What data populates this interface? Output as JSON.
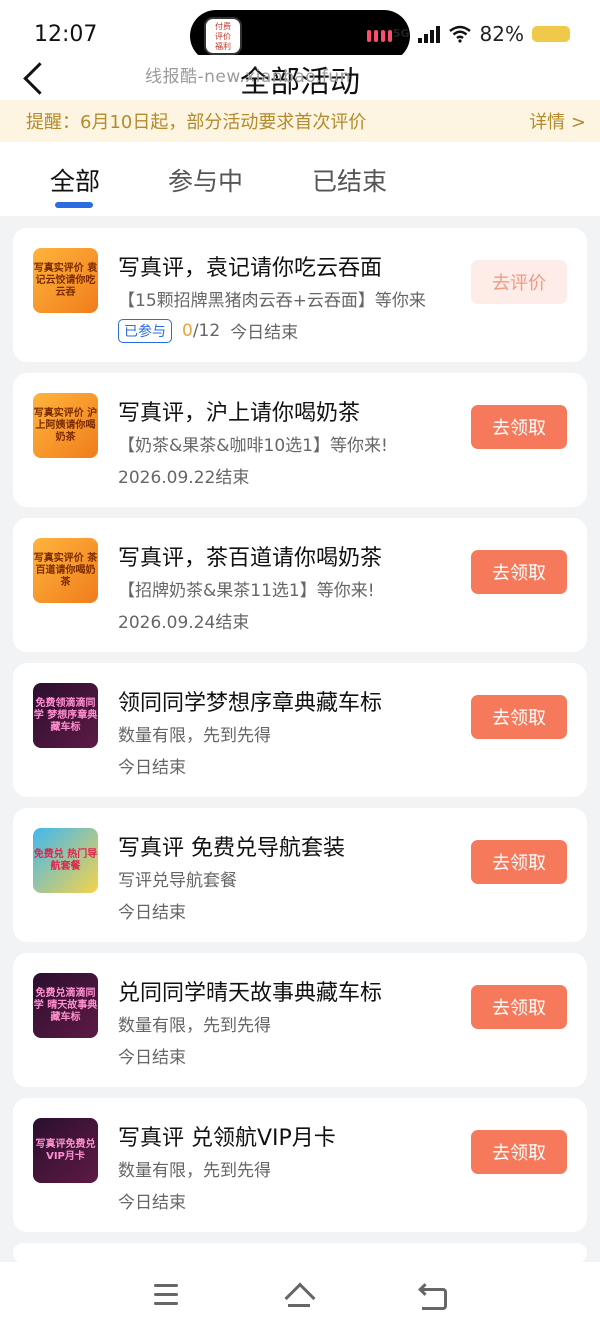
{
  "status_bar": {
    "time": "12:07",
    "network": "5G",
    "battery": "82%"
  },
  "header": {
    "title": "全部活动",
    "watermark": "线报酷-new.xianbao.fun"
  },
  "notice": {
    "text": "提醒：6月10日起，部分活动要求首次评价",
    "detail": "详情 >"
  },
  "tabs": [
    {
      "label": "全部",
      "active": true
    },
    {
      "label": "参与中",
      "active": false
    },
    {
      "label": "已结束",
      "active": false
    }
  ],
  "activities": [
    {
      "thumb_text": "写真实评价 袁记云饺请你吃云吞",
      "title": "写真评，袁记请你吃云吞面",
      "subtitle": "【15颗招牌黑猪肉云吞+云吞面】等你来",
      "joined_badge": "已参与",
      "progress_done": "0",
      "progress_total": "/12",
      "end_text": "今日结束",
      "button": "去评价"
    },
    {
      "thumb_text": "写真实评价 沪上阿姨请你喝奶茶",
      "title": "写真评，沪上请你喝奶茶",
      "subtitle": "【奶茶&果茶&咖啡10选1】等你来!",
      "end_text": "2026.09.22结束",
      "button": "去领取"
    },
    {
      "thumb_text": "写真实评价 茶百道请你喝奶茶",
      "title": "写真评，茶百道请你喝奶茶",
      "subtitle": "【招牌奶茶&果茶11选1】等你来!",
      "end_text": "2026.09.24结束",
      "button": "去领取"
    },
    {
      "thumb_text": "免费领滴滴同学 梦想序章典藏车标",
      "title": "领同同学梦想序章典藏车标",
      "subtitle": "数量有限，先到先得",
      "end_text": "今日结束",
      "button": "去领取"
    },
    {
      "thumb_text": "免费兑 热门导航套餐",
      "title": "写真评 免费兑导航套装",
      "subtitle": "写评兑导航套餐",
      "end_text": "今日结束",
      "button": "去领取"
    },
    {
      "thumb_text": "免费兑滴滴同学 晴天故事典藏车标",
      "title": "兑同同学晴天故事典藏车标",
      "subtitle": "数量有限，先到先得",
      "end_text": "今日结束",
      "button": "去领取"
    },
    {
      "thumb_text": "写真评免费兑VIP月卡",
      "title": "写真评 兑领航VIP月卡",
      "subtitle": "数量有限，先到先得",
      "end_text": "今日结束",
      "button": "去领取"
    }
  ],
  "icons": {
    "back": "back-arrow-icon",
    "menu": "menu-icon",
    "home": "home-icon",
    "nav_back": "return-icon"
  },
  "colors": {
    "accent": "#f5795a",
    "tab_indicator": "#2a6de0",
    "notice_bg": "#fdf5e2",
    "notice_text": "#b38a2c",
    "progress": "#e8a33b"
  }
}
